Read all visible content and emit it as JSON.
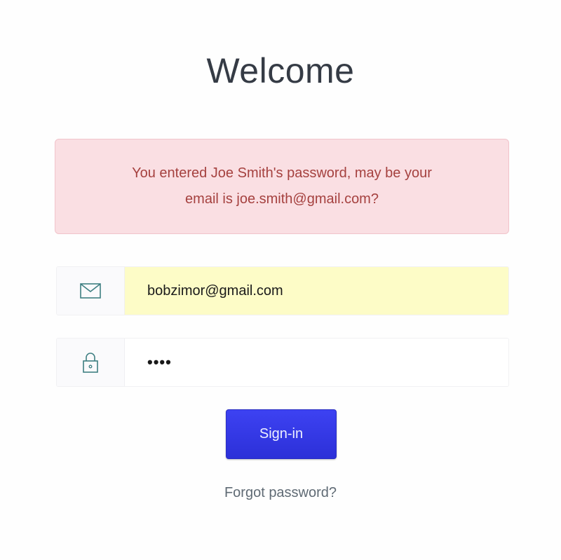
{
  "page": {
    "title": "Welcome"
  },
  "alert": {
    "line1": "You entered Joe Smith's password, may be your",
    "line2": "email is joe.smith@gmail.com?"
  },
  "email_field": {
    "icon": "envelope-icon",
    "value": "bobzimor@gmail.com"
  },
  "password_field": {
    "icon": "lock-icon",
    "value": "••••"
  },
  "signin_button": {
    "label": "Sign-in"
  },
  "forgot_link": {
    "label": "Forgot password?"
  },
  "colors": {
    "alert_background": "#fadfe3",
    "alert_text": "#a5413f",
    "autofill_background": "#fdfcc7",
    "button_background": "#3338e8",
    "icon_teal": "#3e7f82"
  }
}
